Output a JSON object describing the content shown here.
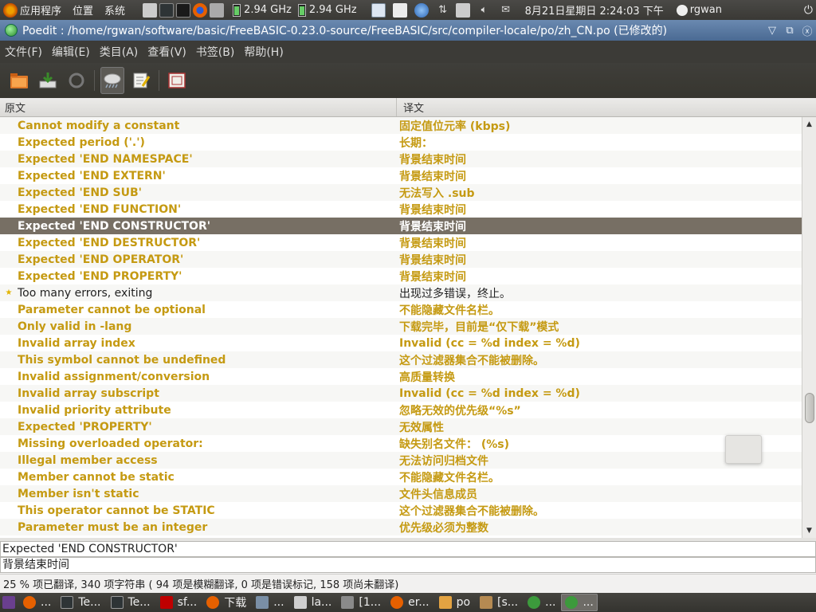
{
  "top_panel": {
    "menus": [
      "应用程序",
      "位置",
      "系统"
    ],
    "cpu1": "2.94 GHz",
    "cpu2": "2.94 GHz",
    "clock": "8月21日星期日  2:24:03 下午",
    "user": "rgwan"
  },
  "window": {
    "title": "Poedit : /home/rgwan/software/basic/FreeBASIC-0.23.0-source/FreeBASIC/src/compiler-locale/po/zh_CN.po (已修改的)"
  },
  "menubar": [
    "文件(F)",
    "编辑(E)",
    "类目(A)",
    "查看(V)",
    "书签(B)",
    "帮助(H)"
  ],
  "list_header": {
    "source": "原文",
    "translation": "译文"
  },
  "entries": [
    {
      "src": "Cannot modify a constant",
      "tr": "固定值位元率 (kbps)"
    },
    {
      "src": "Expected period ('.')",
      "tr": "长期："
    },
    {
      "src": "Expected 'END NAMESPACE'",
      "tr": "背景结束时间"
    },
    {
      "src": "Expected 'END EXTERN'",
      "tr": "背景结束时间"
    },
    {
      "src": "Expected 'END SUB'",
      "tr": "无法写入 .sub"
    },
    {
      "src": "Expected 'END FUNCTION'",
      "tr": "背景结束时间"
    },
    {
      "src": "Expected 'END CONSTRUCTOR'",
      "tr": "背景结束时间"
    },
    {
      "src": "Expected 'END DESTRUCTOR'",
      "tr": "背景结束时间"
    },
    {
      "src": "Expected 'END OPERATOR'",
      "tr": "背景结束时间"
    },
    {
      "src": "Expected 'END PROPERTY'",
      "tr": "背景结束时间"
    },
    {
      "src": "Too many errors, exiting",
      "tr": "出现过多错误，终止。"
    },
    {
      "src": "Parameter cannot be optional",
      "tr": "不能隐藏文件名栏。"
    },
    {
      "src": "Only valid in -lang",
      "tr": "下载完毕，目前是“仅下载”模式"
    },
    {
      "src": "Invalid array index",
      "tr": "Invalid (cc = %d index = %d)"
    },
    {
      "src": "This symbol cannot be undefined",
      "tr": "这个过滤器集合不能被删除。"
    },
    {
      "src": "Invalid assignment/conversion",
      "tr": "高质量转换"
    },
    {
      "src": "Invalid array subscript",
      "tr": "Invalid (cc = %d index = %d)"
    },
    {
      "src": "Invalid priority attribute",
      "tr": "忽略无效的优先级“%s”"
    },
    {
      "src": "Expected 'PROPERTY'",
      "tr": "无效属性"
    },
    {
      "src": "Missing overloaded operator:",
      "tr": "缺失别名文件：  (%s)"
    },
    {
      "src": "Illegal member access",
      "tr": "无法访问归档文件"
    },
    {
      "src": "Member cannot be static",
      "tr": "不能隐藏文件名栏。"
    },
    {
      "src": "Member isn't static",
      "tr": "文件头信息成员"
    },
    {
      "src": "This operator cannot be STATIC",
      "tr": "这个过滤器集合不能被删除。"
    },
    {
      "src": "Parameter must be an integer",
      "tr": "优先级必须为整数"
    }
  ],
  "editor": {
    "source_text": "Expected 'END CONSTRUCTOR'",
    "translation_text": "背景结束时间"
  },
  "status": "25 % 项已翻译, 340 项字符串 ( 94 项是模糊翻译, 0 项是错误标记, 158 项尚未翻译)",
  "taskbar": [
    {
      "label": "...",
      "icon": "firefox-icon",
      "color": "#e66000"
    },
    {
      "label": "Te...",
      "icon": "terminal-icon",
      "color": "#2e3436"
    },
    {
      "label": "Te...",
      "icon": "terminal-icon",
      "color": "#2e3436"
    },
    {
      "label": "sf...",
      "icon": "filezilla-icon",
      "color": "#bf0000"
    },
    {
      "label": "下载",
      "icon": "firefox-icon",
      "color": "#e66000"
    },
    {
      "label": "...",
      "icon": "app-icon",
      "color": "#7a8fa6"
    },
    {
      "label": "la...",
      "icon": "document-icon",
      "color": "#cfcfcf"
    },
    {
      "label": "[1...",
      "icon": "editor-icon",
      "color": "#8a8a8a"
    },
    {
      "label": "er...",
      "icon": "firefox-icon",
      "color": "#e66000"
    },
    {
      "label": "po",
      "icon": "folder-icon",
      "color": "#e3a342"
    },
    {
      "label": "[s...",
      "icon": "folder-icon",
      "color": "#b58a52"
    },
    {
      "label": "...",
      "icon": "poedit-icon",
      "color": "#3c9a3c"
    },
    {
      "label": "...",
      "icon": "poedit-icon",
      "color": "#3c9a3c"
    }
  ]
}
